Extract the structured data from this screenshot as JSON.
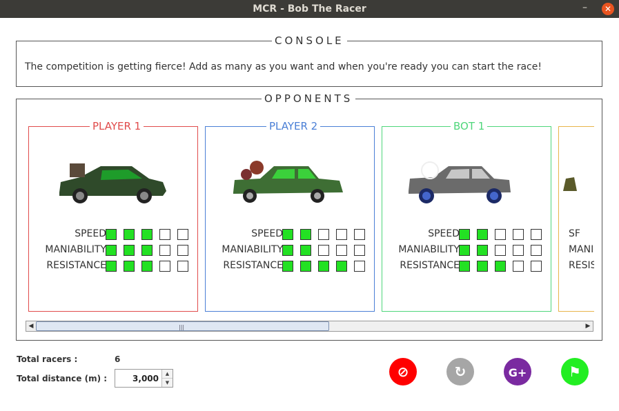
{
  "window": {
    "title": "MCR - Bob The Racer",
    "minimize": "–",
    "close": "✕"
  },
  "console": {
    "legend": "CONSOLE",
    "message": "The competition is getting fierce! Add as many as you want and when you're ready you can start the race!"
  },
  "opponents": {
    "legend": "OPPONENTS",
    "stat_labels": [
      "SPEED",
      "MANIABILITY",
      "RESISTANCE"
    ],
    "cards": [
      {
        "name": "PLAYER 1",
        "color": "#e04b4b",
        "stats": {
          "speed": 3,
          "maniability": 3,
          "resistance": 3
        }
      },
      {
        "name": "PLAYER 2",
        "color": "#4a7fd6",
        "stats": {
          "speed": 2,
          "maniability": 2,
          "resistance": 4
        }
      },
      {
        "name": "BOT 1",
        "color": "#4ed67a",
        "stats": {
          "speed": 2,
          "maniability": 2,
          "resistance": 3
        }
      },
      {
        "name": "",
        "color": "#e8b44a",
        "stats": {
          "speed": 0,
          "maniability": 0,
          "resistance": 0
        },
        "partial_labels": [
          "SF",
          "MANI",
          "RESIS"
        ]
      }
    ],
    "max_stat": 5
  },
  "footer": {
    "total_racers_label": "Total racers :",
    "total_racers_value": "6",
    "total_distance_label": "Total distance (m) :",
    "total_distance_value": "3,000"
  },
  "actions": [
    {
      "name": "cancel-button",
      "icon": "ban-icon",
      "glyph": "⊘",
      "color": "#ff0000"
    },
    {
      "name": "reset-button",
      "icon": "reload-icon",
      "glyph": "↻",
      "color": "#a6a6a6"
    },
    {
      "name": "add-bot-button",
      "icon": "add-bot-icon",
      "glyph": "G+",
      "color": "#7a2aa0"
    },
    {
      "name": "start-race-button",
      "icon": "checkered-flag-icon",
      "glyph": "⚑",
      "color": "#22ee22"
    }
  ]
}
